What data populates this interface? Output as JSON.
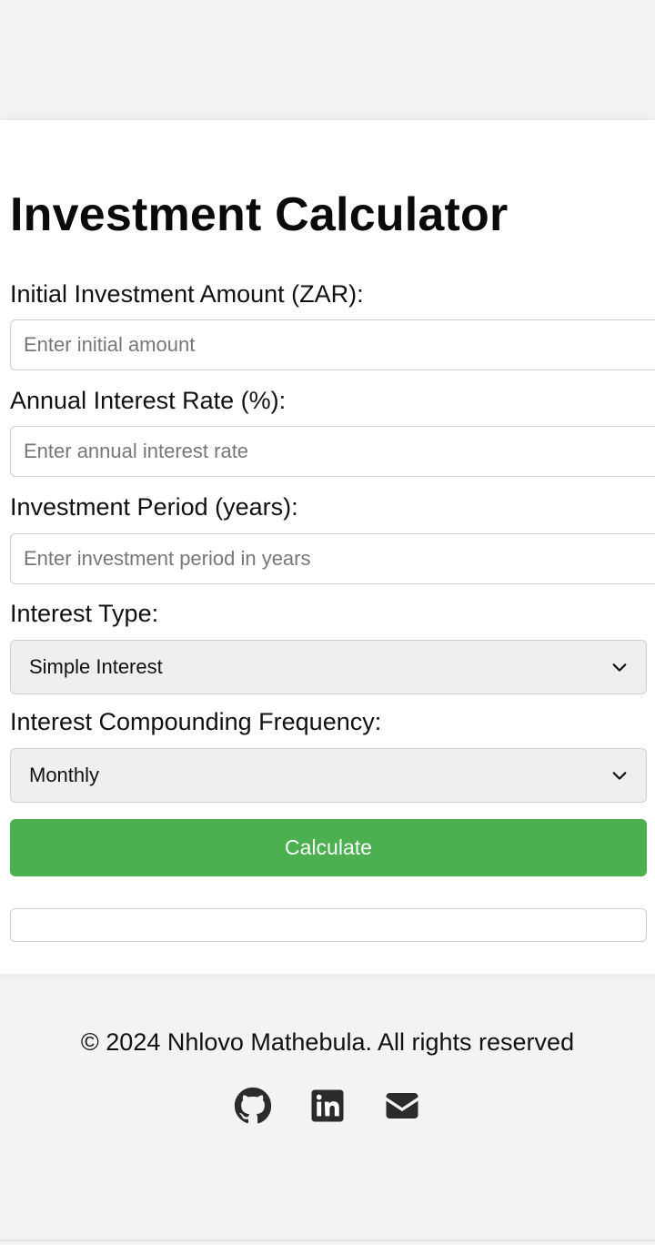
{
  "page": {
    "title": "Investment Calculator"
  },
  "form": {
    "initial_amount": {
      "label": "Initial Investment Amount (ZAR):",
      "placeholder": "Enter initial amount"
    },
    "interest_rate": {
      "label": "Annual Interest Rate (%):",
      "placeholder": "Enter annual interest rate"
    },
    "period": {
      "label": "Investment Period (years):",
      "placeholder": "Enter investment period in years"
    },
    "interest_type": {
      "label": "Interest Type:",
      "selected": "Simple Interest"
    },
    "frequency": {
      "label": "Interest Compounding Frequency:",
      "selected": "Monthly"
    },
    "calculate_label": "Calculate",
    "result": ""
  },
  "footer": {
    "copyright": "© 2024 Nhlovo Mathebula. All rights reserved",
    "icons": [
      "github-icon",
      "linkedin-icon",
      "envelope-icon"
    ]
  },
  "colors": {
    "accent": "#4caf50",
    "background": "#f3f3f3",
    "card": "#ffffff",
    "icon": "#2b2b2b"
  }
}
